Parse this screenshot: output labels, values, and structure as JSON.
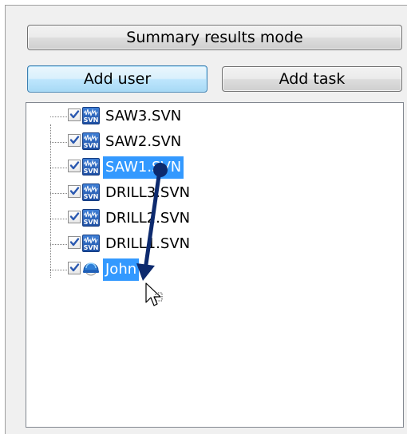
{
  "buttons": {
    "summary_mode": "Summary results mode",
    "add_user": "Add user",
    "add_task": "Add task"
  },
  "tree": {
    "items": [
      {
        "label": "SAW3.SVN",
        "type": "task",
        "icon": "svn-file-icon",
        "checked": true,
        "selected": false
      },
      {
        "label": "SAW2.SVN",
        "type": "task",
        "icon": "svn-file-icon",
        "checked": true,
        "selected": false
      },
      {
        "label": "SAW1.SVN",
        "type": "task",
        "icon": "svn-file-icon",
        "checked": true,
        "selected": true
      },
      {
        "label": "DRILL3.SVN",
        "type": "task",
        "icon": "svn-file-icon",
        "checked": true,
        "selected": false
      },
      {
        "label": "DRILL2.SVN",
        "type": "task",
        "icon": "svn-file-icon",
        "checked": true,
        "selected": false
      },
      {
        "label": "DRILL1.SVN",
        "type": "task",
        "icon": "svn-file-icon",
        "checked": true,
        "selected": false
      },
      {
        "label": "John",
        "type": "user",
        "icon": "user-helmet-icon",
        "checked": true,
        "selected": true
      }
    ],
    "svn_icon_text": "SVN"
  },
  "drag_annotation": {
    "from": "SAW1.SVN",
    "to": "John",
    "arrow_color": "#0d2a6e"
  },
  "colors": {
    "selection": "#3399ff",
    "checkmark": "#2a58b0"
  }
}
